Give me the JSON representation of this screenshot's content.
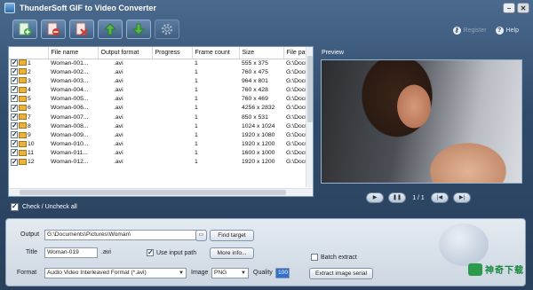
{
  "window": {
    "title": "ThunderSoft GIF to Video Converter"
  },
  "toolbar": {
    "items": [
      "add-files",
      "remove",
      "clear",
      "move-up",
      "move-down",
      "settings"
    ]
  },
  "links": {
    "register": "Register",
    "help": "Help"
  },
  "table": {
    "headers": [
      "",
      "File name",
      "Output format",
      "Progress",
      "Frame count",
      "Size",
      "File pat"
    ],
    "rows": [
      {
        "num": "1",
        "name": "Woman-001...",
        "format": ".avi",
        "progress": "",
        "frames": "1",
        "size": "555 x 375",
        "path": "G:\\Docu"
      },
      {
        "num": "2",
        "name": "Woman-002...",
        "format": ".avi",
        "progress": "",
        "frames": "1",
        "size": "760 x 475",
        "path": "G:\\Docu"
      },
      {
        "num": "3",
        "name": "Woman-003...",
        "format": ".avi",
        "progress": "",
        "frames": "1",
        "size": "964 x 801",
        "path": "G:\\Docu"
      },
      {
        "num": "4",
        "name": "Woman-004...",
        "format": ".avi",
        "progress": "",
        "frames": "1",
        "size": "760 x 428",
        "path": "G:\\Docu"
      },
      {
        "num": "5",
        "name": "Woman-005...",
        "format": ".avi",
        "progress": "",
        "frames": "1",
        "size": "760 x 469",
        "path": "G:\\Docu"
      },
      {
        "num": "6",
        "name": "Woman-006...",
        "format": ".avi",
        "progress": "",
        "frames": "1",
        "size": "4256 x 2832",
        "path": "G:\\Docu"
      },
      {
        "num": "7",
        "name": "Woman-007...",
        "format": ".avi",
        "progress": "",
        "frames": "1",
        "size": "850 x 531",
        "path": "G:\\Docu"
      },
      {
        "num": "8",
        "name": "Woman-008...",
        "format": ".avi",
        "progress": "",
        "frames": "1",
        "size": "1024 x 1024",
        "path": "G:\\Docu"
      },
      {
        "num": "9",
        "name": "Woman-009...",
        "format": ".avi",
        "progress": "",
        "frames": "1",
        "size": "1920 x 1080",
        "path": "G:\\Docu"
      },
      {
        "num": "10",
        "name": "Woman-010...",
        "format": ".avi",
        "progress": "",
        "frames": "1",
        "size": "1920 x 1200",
        "path": "G:\\Docu"
      },
      {
        "num": "11",
        "name": "Woman-011...",
        "format": ".avi",
        "progress": "",
        "frames": "1",
        "size": "1600 x 1000",
        "path": "G:\\Docu"
      },
      {
        "num": "12",
        "name": "Woman-012...",
        "format": ".avi",
        "progress": "",
        "frames": "1",
        "size": "1920 x 1200",
        "path": "G:\\Docu"
      }
    ]
  },
  "check_all_label": "Check / Uncheck all",
  "preview": {
    "label": "Preview",
    "counter": "1 / 1"
  },
  "output": {
    "output_label": "Output",
    "output_path": "G:\\Documents\\Pictures\\Woman\\",
    "find_target": "Find target",
    "title_label": "Title",
    "title_value": "Woman-019",
    "title_ext": ".avi",
    "use_input_path": "Use input path",
    "more_info": "More info...",
    "batch_extract": "Batch extract",
    "format_label": "Format",
    "format_value": "Audio Video Interleaved Format (*.avi)",
    "image_label": "Image",
    "image_value": "PNG",
    "quality_label": "Quality",
    "quality_value": "100",
    "extract_serial": "Extract image serial"
  },
  "watermark": {
    "text": "神奇下载"
  }
}
